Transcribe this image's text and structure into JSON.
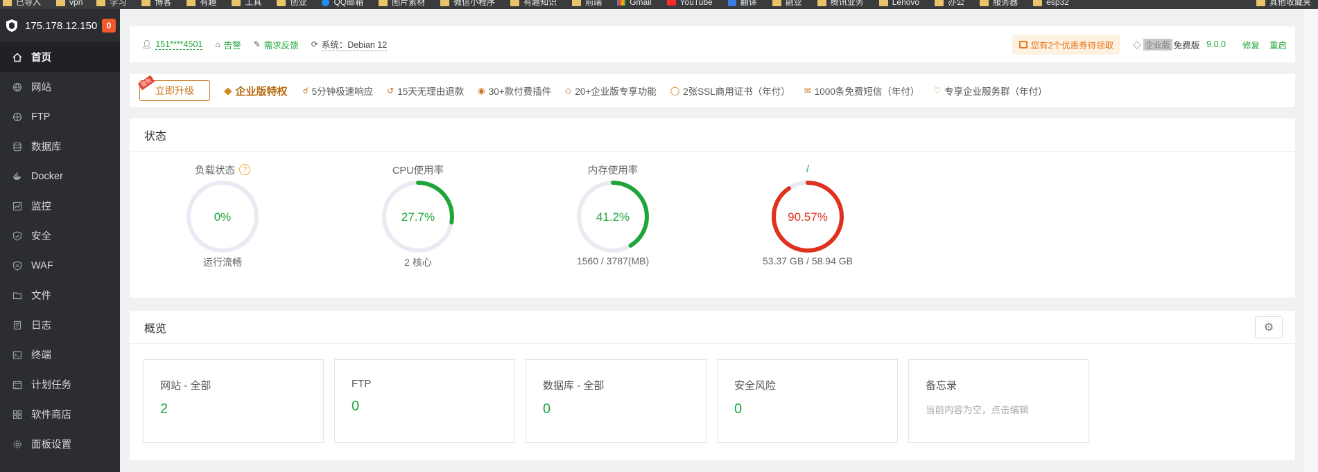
{
  "bookmarks": {
    "items": [
      {
        "label": "已导入",
        "icon": "folder-icon"
      },
      {
        "label": "vpn",
        "icon": "folder-icon"
      },
      {
        "label": "学习",
        "icon": "folder-icon"
      },
      {
        "label": "博客",
        "icon": "folder-icon"
      },
      {
        "label": "有趣",
        "icon": "folder-icon"
      },
      {
        "label": "工具",
        "icon": "folder-icon"
      },
      {
        "label": "创业",
        "icon": "folder-icon"
      },
      {
        "label": "QQ邮箱",
        "icon": "qq-icon"
      },
      {
        "label": "图片素材",
        "icon": "folder-icon"
      },
      {
        "label": "微信小程序",
        "icon": "folder-icon"
      },
      {
        "label": "有趣知识",
        "icon": "folder-icon"
      },
      {
        "label": "前端",
        "icon": "folder-icon"
      },
      {
        "label": "Gmail",
        "icon": "gmail-icon"
      },
      {
        "label": "YouTube",
        "icon": "youtube-icon"
      },
      {
        "label": "翻译",
        "icon": "translate-icon"
      },
      {
        "label": "副业",
        "icon": "folder-icon"
      },
      {
        "label": "腾讯业务",
        "icon": "folder-icon"
      },
      {
        "label": "Lenovo",
        "icon": "folder-icon"
      },
      {
        "label": "办公",
        "icon": "folder-icon"
      },
      {
        "label": "服务器",
        "icon": "folder-icon"
      },
      {
        "label": "esp32",
        "icon": "folder-icon"
      }
    ],
    "other": "其他收藏夹"
  },
  "sidebar": {
    "host": "175.178.12.150",
    "badge": "0",
    "items": [
      {
        "label": "首页",
        "icon": "home-icon"
      },
      {
        "label": "网站",
        "icon": "globe-icon"
      },
      {
        "label": "FTP",
        "icon": "globe-icon"
      },
      {
        "label": "数据库",
        "icon": "database-icon"
      },
      {
        "label": "Docker",
        "icon": "docker-icon"
      },
      {
        "label": "监控",
        "icon": "monitor-icon"
      },
      {
        "label": "安全",
        "icon": "shield-icon"
      },
      {
        "label": "WAF",
        "icon": "waf-shield-icon"
      },
      {
        "label": "文件",
        "icon": "folder-icon"
      },
      {
        "label": "日志",
        "icon": "log-icon"
      },
      {
        "label": "终端",
        "icon": "terminal-icon"
      },
      {
        "label": "计划任务",
        "icon": "calendar-icon"
      },
      {
        "label": "软件商店",
        "icon": "grid-icon"
      },
      {
        "label": "面板设置",
        "icon": "gear-icon"
      }
    ]
  },
  "topbar": {
    "user": "151****4501",
    "alert": "告警",
    "feedback": "需求反馈",
    "system": "系统：Debian 12",
    "coupon": "您有2个优惠券待领取",
    "enterprise": "企业版",
    "edition": "免费版",
    "version": "9.0.0",
    "repair": "修复",
    "restart": "重启"
  },
  "promo": {
    "upgrade": "立即升级",
    "upgrade_tag": "限免",
    "privilege": "企业版特权",
    "features": [
      "5分钟极速响应",
      "15天无理由退款",
      "30+款付费插件",
      "20+企业版专享功能",
      "2张SSL商用证书（年付）",
      "1000条免费短信（年付）",
      "专享企业服务群（年付）"
    ]
  },
  "status": {
    "title": "状态",
    "gauges": [
      {
        "title": "负载状态",
        "value": "0%",
        "percent": 0,
        "sub": "运行流畅",
        "color": "#20a53a",
        "help": "?"
      },
      {
        "title": "CPU使用率",
        "value": "27.7%",
        "percent": 27.7,
        "sub": "2 核心",
        "color": "#20a53a"
      },
      {
        "title": "内存使用率",
        "value": "41.2%",
        "percent": 41.2,
        "sub": "1560 / 3787(MB)",
        "color": "#20a53a"
      },
      {
        "title": "/",
        "value": "90.57%",
        "percent": 90.57,
        "sub": "53.37 GB / 58.94 GB",
        "color": "#e0301e"
      }
    ]
  },
  "overview": {
    "title": "概览",
    "cards": [
      {
        "title": "网站 - 全部",
        "value": "2"
      },
      {
        "title": "FTP",
        "value": "0"
      },
      {
        "title": "数据库 - 全部",
        "value": "0"
      },
      {
        "title": "安全风险",
        "value": "0"
      },
      {
        "title": "备忘录",
        "note": "当前内容为空，点击编辑"
      }
    ]
  }
}
